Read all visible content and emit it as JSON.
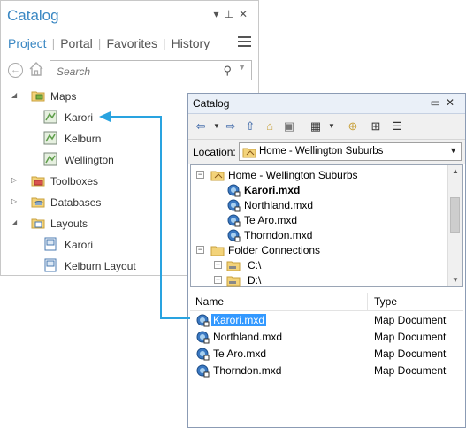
{
  "pro_pane": {
    "title": "Catalog",
    "tabs": [
      "Project",
      "Portal",
      "Favorites",
      "History"
    ],
    "search_placeholder": "Search",
    "tree": {
      "maps": {
        "label": "Maps",
        "children": [
          "Karori",
          "Kelburn",
          "Wellington"
        ]
      },
      "toolboxes": "Toolboxes",
      "databases": "Databases",
      "layouts": {
        "label": "Layouts",
        "children": [
          "Karori",
          "Kelburn Layout"
        ]
      }
    }
  },
  "classic_window": {
    "title": "Catalog",
    "location_label": "Location:",
    "location_value": "Home - Wellington Suburbs",
    "tree": {
      "home": "Home - Wellington Suburbs",
      "home_children": [
        "Karori.mxd",
        "Northland.mxd",
        "Te Aro.mxd",
        "Thorndon.mxd"
      ],
      "folder_connections": "Folder Connections",
      "drives": [
        "C:\\",
        "D:\\"
      ]
    },
    "list": {
      "col_name": "Name",
      "col_type": "Type",
      "rows": [
        {
          "name": "Karori.mxd",
          "type": "Map Document"
        },
        {
          "name": "Northland.mxd",
          "type": "Map Document"
        },
        {
          "name": "Te Aro.mxd",
          "type": "Map Document"
        },
        {
          "name": "Thorndon.mxd",
          "type": "Map Document"
        }
      ]
    }
  },
  "colors": {
    "accent": "#3b88c3",
    "connector": "#29a3e0",
    "selection": "#3399ff"
  }
}
